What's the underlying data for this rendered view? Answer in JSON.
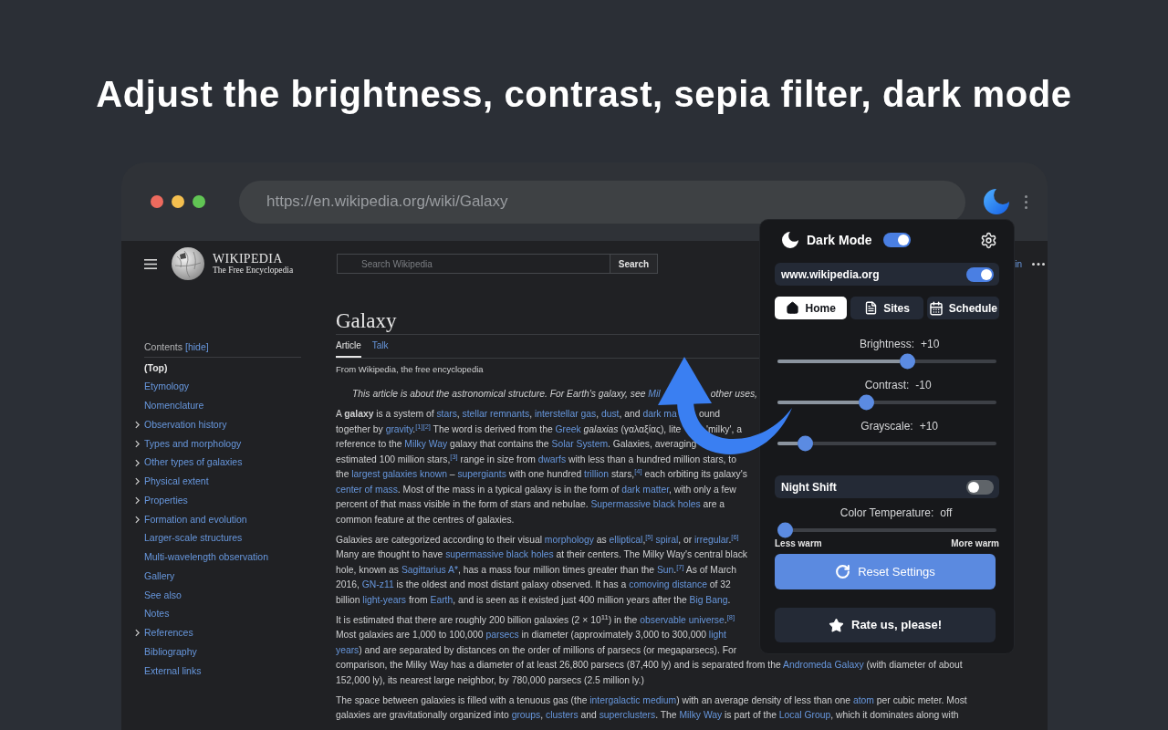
{
  "headline": "Adjust the brightness, contrast, sepia filter, dark mode",
  "browser": {
    "url": "https://en.wikipedia.org/wiki/Galaxy"
  },
  "wikipedia": {
    "wordmark": "WIKIPEDIA",
    "tagline": "The Free Encyclopedia",
    "search": {
      "placeholder": "Search Wikipedia",
      "button": "Search"
    },
    "account_link": "in",
    "contents": {
      "title": "Contents",
      "toggle": "[hide]",
      "items": [
        {
          "label": "(Top)",
          "selected": true,
          "collapsible": false
        },
        {
          "label": "Etymology",
          "selected": false,
          "collapsible": false
        },
        {
          "label": "Nomenclature",
          "selected": false,
          "collapsible": false
        },
        {
          "label": "Observation history",
          "selected": false,
          "collapsible": true
        },
        {
          "label": "Types and morphology",
          "selected": false,
          "collapsible": true
        },
        {
          "label": "Other types of galaxies",
          "selected": false,
          "collapsible": true
        },
        {
          "label": "Physical extent",
          "selected": false,
          "collapsible": true
        },
        {
          "label": "Properties",
          "selected": false,
          "collapsible": true
        },
        {
          "label": "Formation and evolution",
          "selected": false,
          "collapsible": true
        },
        {
          "label": "Larger-scale structures",
          "selected": false,
          "collapsible": false
        },
        {
          "label": "Multi-wavelength observation",
          "selected": false,
          "collapsible": false
        },
        {
          "label": "Gallery",
          "selected": false,
          "collapsible": false
        },
        {
          "label": "See also",
          "selected": false,
          "collapsible": false
        },
        {
          "label": "Notes",
          "selected": false,
          "collapsible": false
        },
        {
          "label": "References",
          "selected": false,
          "collapsible": true
        },
        {
          "label": "Bibliography",
          "selected": false,
          "collapsible": false
        },
        {
          "label": "External links",
          "selected": false,
          "collapsible": false
        }
      ]
    },
    "article": {
      "title": "Galaxy",
      "tabs": [
        {
          "label": "Article",
          "selected": true
        },
        {
          "label": "Talk",
          "selected": false
        }
      ],
      "source_note": "From Wikipedia, the free encyclopedia",
      "hatnote": [
        "This article is about the astronomical structure. For Earth's galaxy, see ",
        {
          "link": "Mil"
        },
        {
          "after_arrow": "other uses,"
        }
      ],
      "paragraphs": [
        [
          [
            "A **galaxy** is a system of ",
            {
              "link": "stars"
            },
            ", ",
            {
              "link": "stellar remnants"
            },
            ", ",
            {
              "link": "interstellar gas"
            },
            ", ",
            {
              "link": "dust"
            },
            ", and ",
            {
              "link": "dark ma"
            },
            {
              "after_arrow": "ound"
            }
          ],
          [
            "together by ",
            {
              "link": "gravity"
            },
            ".",
            {
              "ref": "[1][2]"
            },
            " The word is derived from the ",
            {
              "link": "Greek"
            },
            " *galaxias* (γαλαξίας), lite",
            {
              "after_arrow": "'milky', a"
            }
          ],
          [
            "reference to the ",
            {
              "link": "Milky Way"
            },
            " galaxy that contains the ",
            {
              "link": "Solar System"
            },
            ". Galaxies, averaging"
          ],
          [
            "estimated 100 million stars,",
            {
              "ref": "[3]"
            },
            " range in size from ",
            {
              "link": "dwarfs"
            },
            " with less than a hundred million stars, to"
          ],
          [
            "the ",
            {
              "link": "largest galaxies known"
            },
            " – ",
            {
              "link": "supergiants"
            },
            " with one hundred ",
            {
              "link": "trillion"
            },
            " stars,",
            {
              "ref": "[4]"
            },
            " each orbiting its galaxy's"
          ],
          [
            {
              "link": "center of mass"
            },
            ". Most of the mass in a typical galaxy is in the form of ",
            {
              "link": "dark matter"
            },
            ", with only a few"
          ],
          [
            "percent of that mass visible in the form of stars and nebulae. ",
            {
              "link": "Supermassive black holes"
            },
            " are a"
          ],
          [
            "common feature at the centres of galaxies."
          ]
        ],
        [
          [
            "Galaxies are categorized according to their visual ",
            {
              "link": "morphology"
            },
            " as ",
            {
              "link": "elliptical"
            },
            ",",
            {
              "ref": "[5]"
            },
            {
              "link": "spiral"
            },
            ", or ",
            {
              "link": "irregular"
            },
            ".",
            {
              "ref": "[6]"
            }
          ],
          [
            "Many are thought to have ",
            {
              "link": "supermassive black holes"
            },
            " at their centers. The Milky Way's central black"
          ],
          [
            "hole, known as ",
            {
              "link": "Sagittarius A*"
            },
            ", has a mass four million times greater than the ",
            {
              "link": "Sun"
            },
            ".",
            {
              "ref": "[7]"
            },
            " As of March"
          ],
          [
            "2016, ",
            {
              "link": "GN-z11"
            },
            " is the oldest and most distant galaxy observed. It has a ",
            {
              "link": "comoving distance"
            },
            " of 32"
          ],
          [
            "billion ",
            {
              "link": "light-years"
            },
            " from ",
            {
              "link": "Earth"
            },
            ", and is seen as it existed just 400 million years after the ",
            {
              "link": "Big Bang"
            },
            "."
          ]
        ],
        [
          [
            "It is estimated that there are roughly 200 billion galaxies (2 × 10$^{11}$) in the ",
            {
              "link": "observable universe"
            },
            ".",
            {
              "ref": "[8]"
            }
          ],
          [
            "Most galaxies are 1,000 to 100,000 ",
            {
              "link": "parsecs"
            },
            " in diameter (approximately 3,000 to 300,000 ",
            {
              "link": "light"
            }
          ],
          [
            {
              "link": "years"
            },
            ") and are separated by distances on the order of millions of parsecs (or megaparsecs). For"
          ],
          [
            "comparison, the Milky Way has a diameter of at least 26,800 parsecs (87,400 ly) and is separated from the ",
            {
              "link": "Andromeda Galaxy"
            },
            " (with diameter of about"
          ],
          [
            "152,000 ly), its nearest large neighbor, by 780,000 parsecs (2.5 million ly.)"
          ]
        ],
        [
          [
            "The space between galaxies is filled with a tenuous gas (the ",
            {
              "link": "intergalactic medium"
            },
            ") with an average density of less than one ",
            {
              "link": "atom"
            },
            " per cubic meter. Most"
          ],
          [
            "galaxies are gravitationally organized into ",
            {
              "link": "groups"
            },
            ", ",
            {
              "link": "clusters"
            },
            " and ",
            {
              "link": "superclusters"
            },
            ". The ",
            {
              "link": "Milky Way"
            },
            " is part of the ",
            {
              "link": "Local Group"
            },
            ", which it dominates along with"
          ]
        ]
      ]
    }
  },
  "popup": {
    "title": "Dark Mode",
    "enabled": true,
    "site": {
      "label": "www.wikipedia.org",
      "enabled": true
    },
    "tabs": [
      {
        "label": "Home",
        "selected": true
      },
      {
        "label": "Sites",
        "selected": false
      },
      {
        "label": "Schedule",
        "selected": false
      }
    ],
    "sliders": [
      {
        "label": "Brightness:",
        "reading": "+10",
        "level": 0.6
      },
      {
        "label": "Contrast:",
        "reading": "-10",
        "level": 0.4
      },
      {
        "label": "Grayscale:",
        "reading": "+10",
        "level": 0.1
      }
    ],
    "night_shift": {
      "label": "Night Shift",
      "on": false
    },
    "color_temperature": {
      "label": "Color Temperature:",
      "reading": "off",
      "level": 0,
      "min_label": "Less warm",
      "max_label": "More warm"
    },
    "buttons": [
      {
        "label": "Reset Settings",
        "kind": "reset"
      },
      {
        "label": "Rate us, please!",
        "kind": "rate"
      }
    ]
  }
}
